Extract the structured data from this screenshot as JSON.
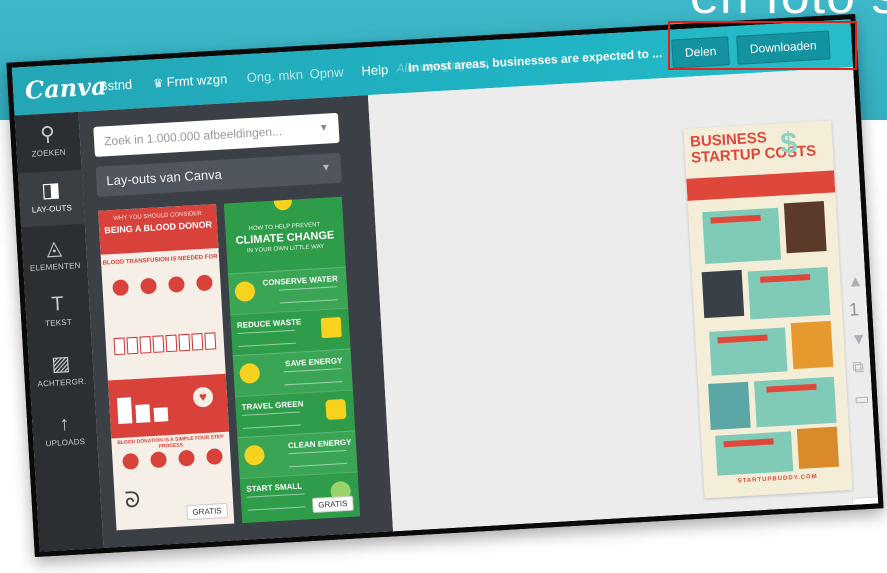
{
  "slide": {
    "title": "en foto s"
  },
  "app": {
    "logo": "Canva",
    "menu": [
      "Bstnd",
      "Frmt wzgn",
      "Ong. mkn",
      "Opnw",
      "Help"
    ],
    "status": "In most areas, businesses are expected to ...",
    "status_faint": "Alle wijzigingen o",
    "share_label": "Delen",
    "download_label": "Downloaden"
  },
  "sidebar": {
    "items": [
      {
        "label": "ZOEKEN",
        "icon": "search-icon"
      },
      {
        "label": "LAY-OUTS",
        "icon": "layout-icon"
      },
      {
        "label": "ELEMENTEN",
        "icon": "elements-icon"
      },
      {
        "label": "TEKST",
        "icon": "text-icon"
      },
      {
        "label": "ACHTERGR.",
        "icon": "background-icon"
      },
      {
        "label": "UPLOADS",
        "icon": "upload-icon"
      }
    ]
  },
  "panel": {
    "search_placeholder": "Zoek in 1.000.000 afbeeldingen...",
    "layout_select": "Lay-outs van Canva",
    "template_a": {
      "kicker": "WHY YOU SHOULD CONSIDER",
      "title": "BEING A BLOOD DONOR",
      "subheading": "BLOOD TRANSFUSION IS NEEDED FOR",
      "subheading2": "BLOOD DONATION IS A SIMPLE FOUR STEP PROCESS",
      "badge": "GRATIS"
    },
    "template_b": {
      "kicker": "HOW TO HELP PREVENT",
      "title": "CLIMATE CHANGE",
      "kicker2": "IN YOUR OWN LITTLE WAY",
      "rows": [
        "CONSERVE WATER",
        "REDUCE WASTE",
        "SAVE ENERGY",
        "TRAVEL GREEN",
        "CLEAN ENERGY",
        "START SMALL"
      ],
      "badge": "GRATIS"
    }
  },
  "design": {
    "title_line1": "BUSINESS",
    "title_line2": "STARTUP COSTS",
    "footer": "STARTUPBUDDY.COM",
    "page_number": "1"
  },
  "colors": {
    "brand_teal": "#1fb3c3",
    "sidebar_dark": "#2b2f33",
    "highlight_red": "#e2211c",
    "blood_red": "#d8423a",
    "climate_green": "#2f9c4a"
  }
}
